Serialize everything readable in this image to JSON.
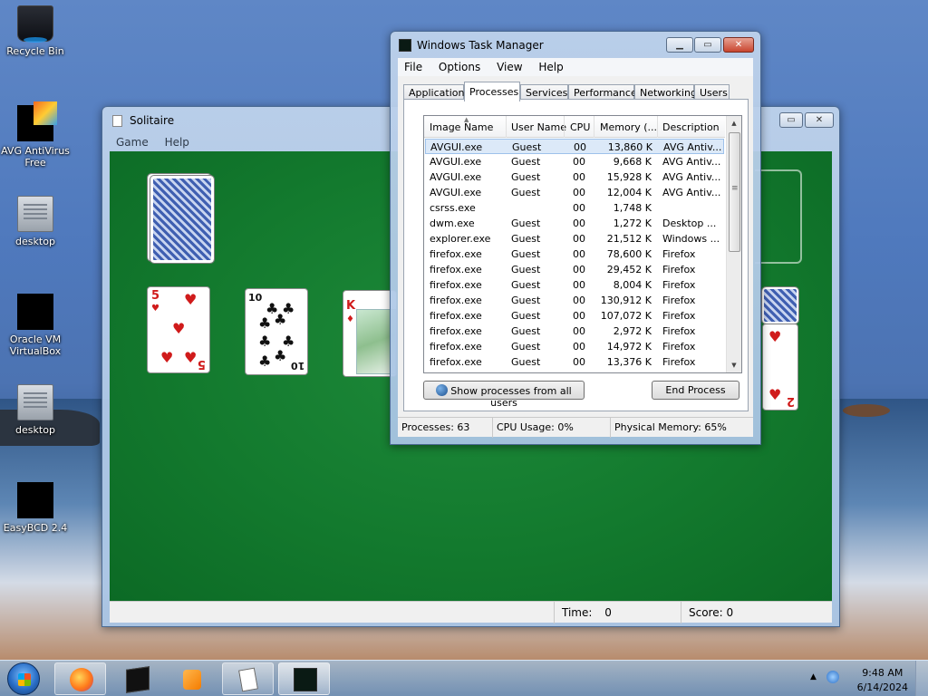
{
  "desktop": {
    "icons": [
      {
        "label": "Recycle Bin",
        "icon": "recycle-bin-icon"
      },
      {
        "label": "AVG AntiVirus Free",
        "icon": "avg-antivirus-icon"
      },
      {
        "label": "desktop",
        "icon": "document-icon"
      },
      {
        "label": "Oracle VM VirtualBox",
        "icon": "virtualbox-icon"
      },
      {
        "label": "desktop",
        "icon": "document-icon"
      },
      {
        "label": "EasyBCD 2.4",
        "icon": "easybcd-icon"
      }
    ]
  },
  "solitaire": {
    "title": "Solitaire",
    "menu": [
      "Game",
      "Help"
    ],
    "status": {
      "time_label": "Time:",
      "time_value": "0",
      "score_label": "Score:",
      "score_value": "0"
    },
    "cards": {
      "five_hearts": {
        "rank": "5",
        "suit": "♥"
      },
      "ten_clubs": {
        "rank": "10",
        "suit": "♣"
      },
      "king_diamonds": {
        "rank": "K",
        "suit": "♦"
      },
      "right_card": {
        "rank": "2",
        "suit": "♥"
      }
    }
  },
  "task_manager": {
    "title": "Windows Task Manager",
    "menu": [
      "File",
      "Options",
      "View",
      "Help"
    ],
    "tabs": [
      "Applications",
      "Processes",
      "Services",
      "Performance",
      "Networking",
      "Users"
    ],
    "active_tab": "Processes",
    "columns": [
      "Image Name",
      "User Name",
      "CPU",
      "Memory (...",
      "Description"
    ],
    "processes": [
      {
        "name": "AVGUI.exe",
        "user": "Guest",
        "cpu": "00",
        "mem": "13,860 K",
        "desc": "AVG Antiv...",
        "selected": true
      },
      {
        "name": "AVGUI.exe",
        "user": "Guest",
        "cpu": "00",
        "mem": "9,668 K",
        "desc": "AVG Antiv..."
      },
      {
        "name": "AVGUI.exe",
        "user": "Guest",
        "cpu": "00",
        "mem": "15,928 K",
        "desc": "AVG Antiv..."
      },
      {
        "name": "AVGUI.exe",
        "user": "Guest",
        "cpu": "00",
        "mem": "12,004 K",
        "desc": "AVG Antiv..."
      },
      {
        "name": "csrss.exe",
        "user": "",
        "cpu": "00",
        "mem": "1,748 K",
        "desc": ""
      },
      {
        "name": "dwm.exe",
        "user": "Guest",
        "cpu": "00",
        "mem": "1,272 K",
        "desc": "Desktop ..."
      },
      {
        "name": "explorer.exe",
        "user": "Guest",
        "cpu": "00",
        "mem": "21,512 K",
        "desc": "Windows ..."
      },
      {
        "name": "firefox.exe",
        "user": "Guest",
        "cpu": "00",
        "mem": "78,600 K",
        "desc": "Firefox"
      },
      {
        "name": "firefox.exe",
        "user": "Guest",
        "cpu": "00",
        "mem": "29,452 K",
        "desc": "Firefox"
      },
      {
        "name": "firefox.exe",
        "user": "Guest",
        "cpu": "00",
        "mem": "8,004 K",
        "desc": "Firefox"
      },
      {
        "name": "firefox.exe",
        "user": "Guest",
        "cpu": "00",
        "mem": "130,912 K",
        "desc": "Firefox"
      },
      {
        "name": "firefox.exe",
        "user": "Guest",
        "cpu": "00",
        "mem": "107,072 K",
        "desc": "Firefox"
      },
      {
        "name": "firefox.exe",
        "user": "Guest",
        "cpu": "00",
        "mem": "2,972 K",
        "desc": "Firefox"
      },
      {
        "name": "firefox.exe",
        "user": "Guest",
        "cpu": "00",
        "mem": "14,972 K",
        "desc": "Firefox"
      },
      {
        "name": "firefox.exe",
        "user": "Guest",
        "cpu": "00",
        "mem": "13,376 K",
        "desc": "Firefox"
      }
    ],
    "show_all_label": "Show processes from all users",
    "end_process_label": "End Process",
    "status": {
      "processes": "Processes: 63",
      "cpu": "CPU Usage: 0%",
      "memory": "Physical Memory: 65%"
    }
  },
  "taskbar": {
    "buttons": [
      {
        "name": "firefox-icon"
      },
      {
        "name": "virtualbox-icon"
      },
      {
        "name": "media-player-icon"
      },
      {
        "name": "solitaire-icon"
      },
      {
        "name": "task-manager-icon"
      }
    ],
    "clock": {
      "time": "9:48 AM",
      "date": "6/14/2024"
    },
    "colors": {
      "accent": "#2a6ec6",
      "felt": "#137a2e",
      "close": "#c8452f"
    }
  }
}
